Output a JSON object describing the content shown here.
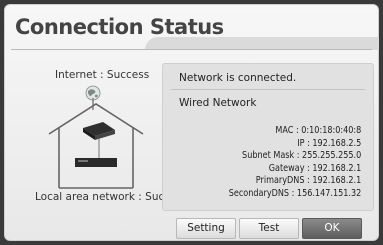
{
  "dialog": {
    "title": "Connection Status"
  },
  "diagram": {
    "internet_label": "Internet : Success",
    "lan_label": "Local area network : Success",
    "globe_icon": "globe-icon",
    "house_icon": "house-network-icon"
  },
  "panel": {
    "status": "Network is connected.",
    "network_type": "Wired Network",
    "rows": [
      "MAC : 0:10:18:0:40:8",
      "IP : 192.168.2.5",
      "Subnet Mask : 255.255.255.0",
      "Gateway : 192.168.2.1",
      "PrimaryDNS : 192.168.2.1",
      "SecondaryDNS : 156.147.151.32"
    ]
  },
  "buttons": {
    "setting": "Setting",
    "test": "Test",
    "ok": "OK"
  },
  "colors": {
    "ok_button": "#6e6e6e",
    "dialog_bg": "#efefef",
    "panel_bg": "#e1e1e1"
  }
}
